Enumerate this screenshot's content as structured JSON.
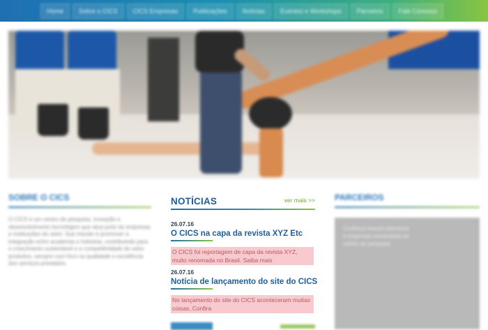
{
  "nav": {
    "items": [
      "Home",
      "Sobre o CICS",
      "CICS Empresas",
      "Publicações",
      "Notícias",
      "Eventos e Workshops",
      "Parceiros",
      "Fale Conosco"
    ]
  },
  "left": {
    "heading": "SOBRE O CICS",
    "text": "O CICS é um centro de pesquisa, inovação e desenvolvimento tecnológico que atua junto às empresas e instituições do setor. Sua missão é promover a integração entre academia e indústria, contribuindo para o crescimento sustentável e a competitividade do setor produtivo, sempre com foco na qualidade e excelência dos serviços prestados."
  },
  "news": {
    "title": "NOTÍCIAS",
    "more": "ver mais >>",
    "items": [
      {
        "date": "26.07.16",
        "title": "O CICS na capa da revista XYZ Etc",
        "excerpt": "O CICS foi reportagem de capa da revista XYZ, muito renomada no Brasil. Saiba mais"
      },
      {
        "date": "26.07.16",
        "title": "Notícia de lançamento do site do CICS",
        "excerpt": "No lançamento do site do CICS aconteceram muitas coisas. Confira"
      }
    ]
  },
  "right": {
    "heading": "PARCEIROS",
    "lines": [
      "Conheça nossos parceiros",
      "e empresas associadas ao",
      "centro de pesquisa"
    ]
  },
  "colors": {
    "accent_blue": "#1f5f99",
    "accent_green": "#8ac440",
    "highlight": "#f8c9cf"
  }
}
